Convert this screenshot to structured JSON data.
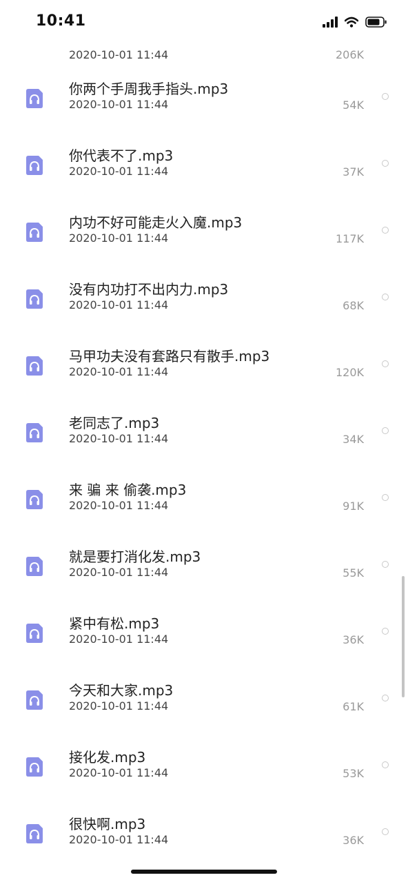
{
  "status_bar": {
    "time": "10:41"
  },
  "partial_item": {
    "date": "2020-10-01 11:44",
    "size": "206K"
  },
  "files": [
    {
      "name": "你两个手周我手指头.mp3",
      "date": "2020-10-01 11:44",
      "size": "54K"
    },
    {
      "name": "你代表不了.mp3",
      "date": "2020-10-01 11:44",
      "size": "37K"
    },
    {
      "name": "内功不好可能走火入魔.mp3",
      "date": "2020-10-01 11:44",
      "size": "117K"
    },
    {
      "name": "没有内功打不出内力.mp3",
      "date": "2020-10-01 11:44",
      "size": "68K"
    },
    {
      "name": "马甲功夫没有套路只有散手.mp3",
      "date": "2020-10-01 11:44",
      "size": "120K"
    },
    {
      "name": "老同志了.mp3",
      "date": "2020-10-01 11:44",
      "size": "34K"
    },
    {
      "name": "来  骗  来  偷袭.mp3",
      "date": "2020-10-01 11:44",
      "size": "91K"
    },
    {
      "name": "就是要打消化发.mp3",
      "date": "2020-10-01 11:44",
      "size": "55K"
    },
    {
      "name": "紧中有松.mp3",
      "date": "2020-10-01 11:44",
      "size": "36K"
    },
    {
      "name": "今天和大家.mp3",
      "date": "2020-10-01 11:44",
      "size": "61K"
    },
    {
      "name": "接化发.mp3",
      "date": "2020-10-01 11:44",
      "size": "53K"
    },
    {
      "name": "很快啊.mp3",
      "date": "2020-10-01 11:44",
      "size": "36K"
    }
  ],
  "colors": {
    "icon_accent": "#8a8fe8",
    "text": "#222222",
    "meta": "#9a9a9a"
  },
  "icons": {
    "file": "headphones-icon"
  }
}
